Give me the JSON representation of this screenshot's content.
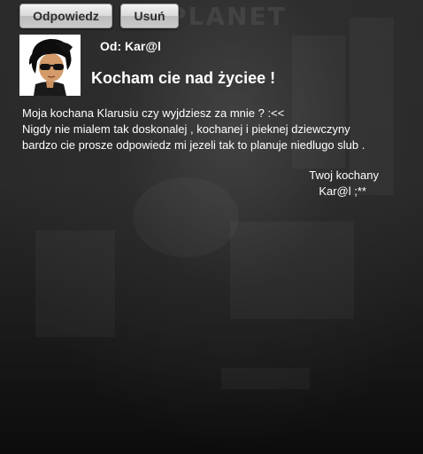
{
  "buttons": {
    "reply": "Odpowiedz",
    "delete": "Usuń"
  },
  "message": {
    "from": "Od: Kar@l",
    "subject": "Kocham cie nad życiee !",
    "body": [
      "Moja kochana Klarusiu czy wyjdziesz za mnie ? :<<",
      "Nigdy nie mialem tak doskonalej , kochanej i pieknej dziewczyny",
      "bardzo cie prosze odpowiedz mi jezeli tak to planuje niedlugo slub ."
    ],
    "signature": {
      "closing": "Twoj kochany",
      "name": "Kar@l ;**"
    }
  },
  "icons": {
    "avatar": "avatar-icon"
  },
  "colors": {
    "background": "#2a2a2a",
    "text": "#ffffff",
    "button": "#d6d6d6"
  }
}
